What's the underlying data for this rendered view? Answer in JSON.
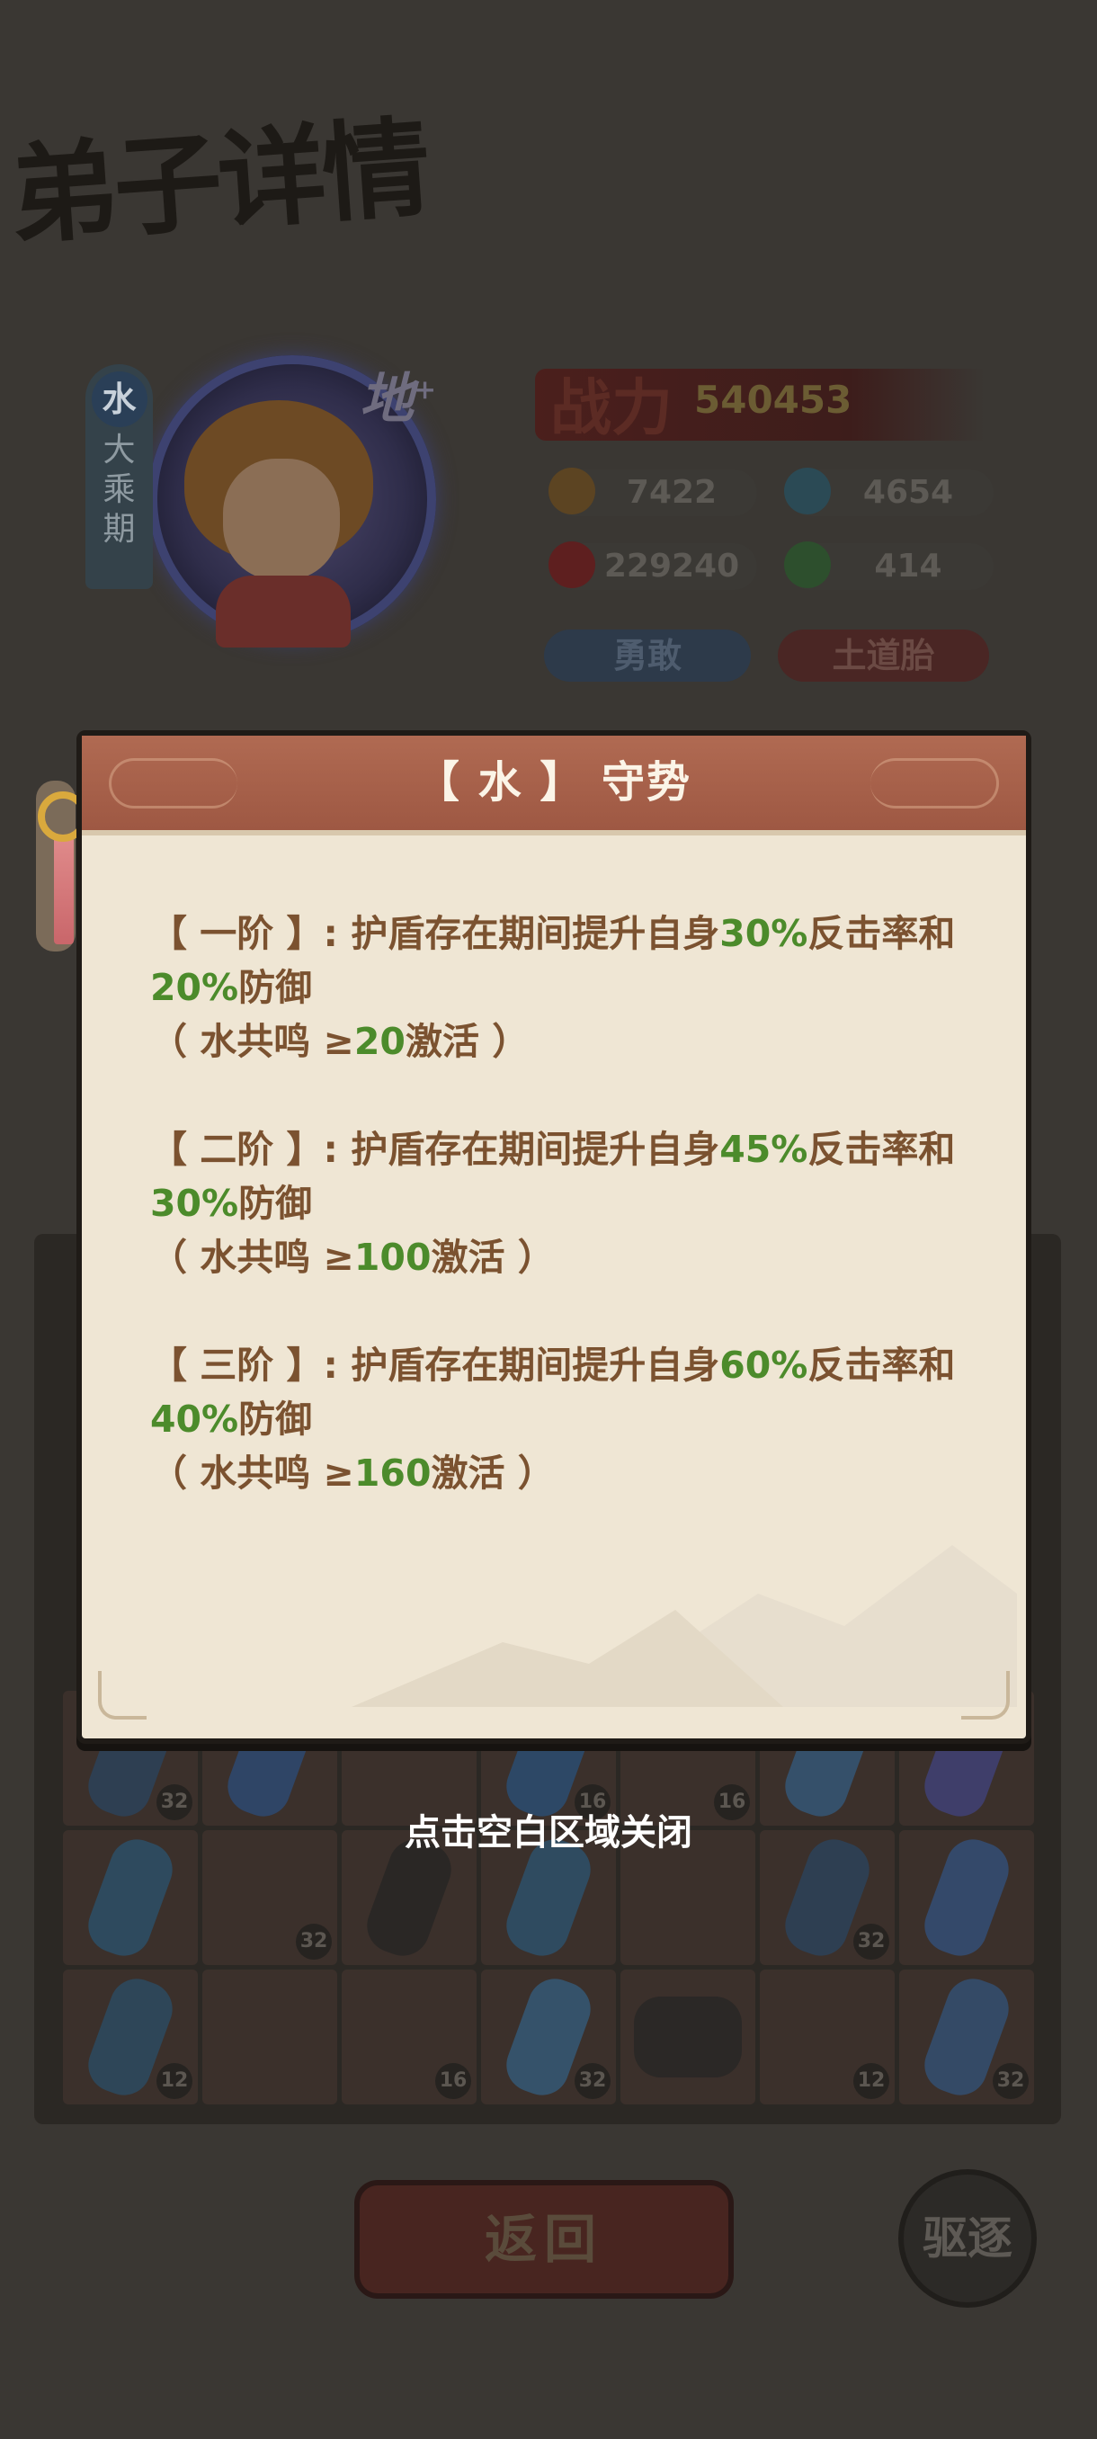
{
  "screen": {
    "title": "弟子详情",
    "close_hint": "点击空白区域关闭"
  },
  "disciple": {
    "element": "水",
    "realm": "大乘期",
    "grade": "地",
    "power_label": "战力",
    "power_value": "540453",
    "stats": {
      "attack": "7422",
      "defense": "4654",
      "hp": "229240",
      "speed": "414"
    },
    "traits": [
      "勇敢",
      "土道胎"
    ]
  },
  "item_levels": [
    "32",
    "16",
    "16",
    "32",
    "32",
    "12",
    "16",
    "32",
    "12",
    "32"
  ],
  "dialog": {
    "title": "【 水 】 守势",
    "tiers": [
      {
        "prefix": "【 一阶 】: 护盾存在期间提升自身",
        "counter_value": "30%",
        "mid": "反击率和",
        "defense_value": "20%",
        "suffix": "防御",
        "req_prefix": "（ 水共鸣 ≥",
        "req_value": "20",
        "req_suffix": "激活 ）"
      },
      {
        "prefix": "【 二阶 】: 护盾存在期间提升自身",
        "counter_value": "45%",
        "mid": "反击率和",
        "defense_value": "30%",
        "suffix": "防御",
        "req_prefix": "（ 水共鸣 ≥",
        "req_value": "100",
        "req_suffix": "激活 ）"
      },
      {
        "prefix": "【 三阶 】: 护盾存在期间提升自身",
        "counter_value": "60%",
        "mid": "反击率和",
        "defense_value": "40%",
        "suffix": "防御",
        "req_prefix": "（ 水共鸣 ≥",
        "req_value": "160",
        "req_suffix": "激活 ）"
      }
    ]
  },
  "buttons": {
    "back": "返回",
    "expel": "驱逐"
  },
  "colors": {
    "dialog_header": "#a25c46",
    "dialog_body": "#efe6d4",
    "text_brown": "#7b5230",
    "value_green": "#4c8b2b"
  }
}
